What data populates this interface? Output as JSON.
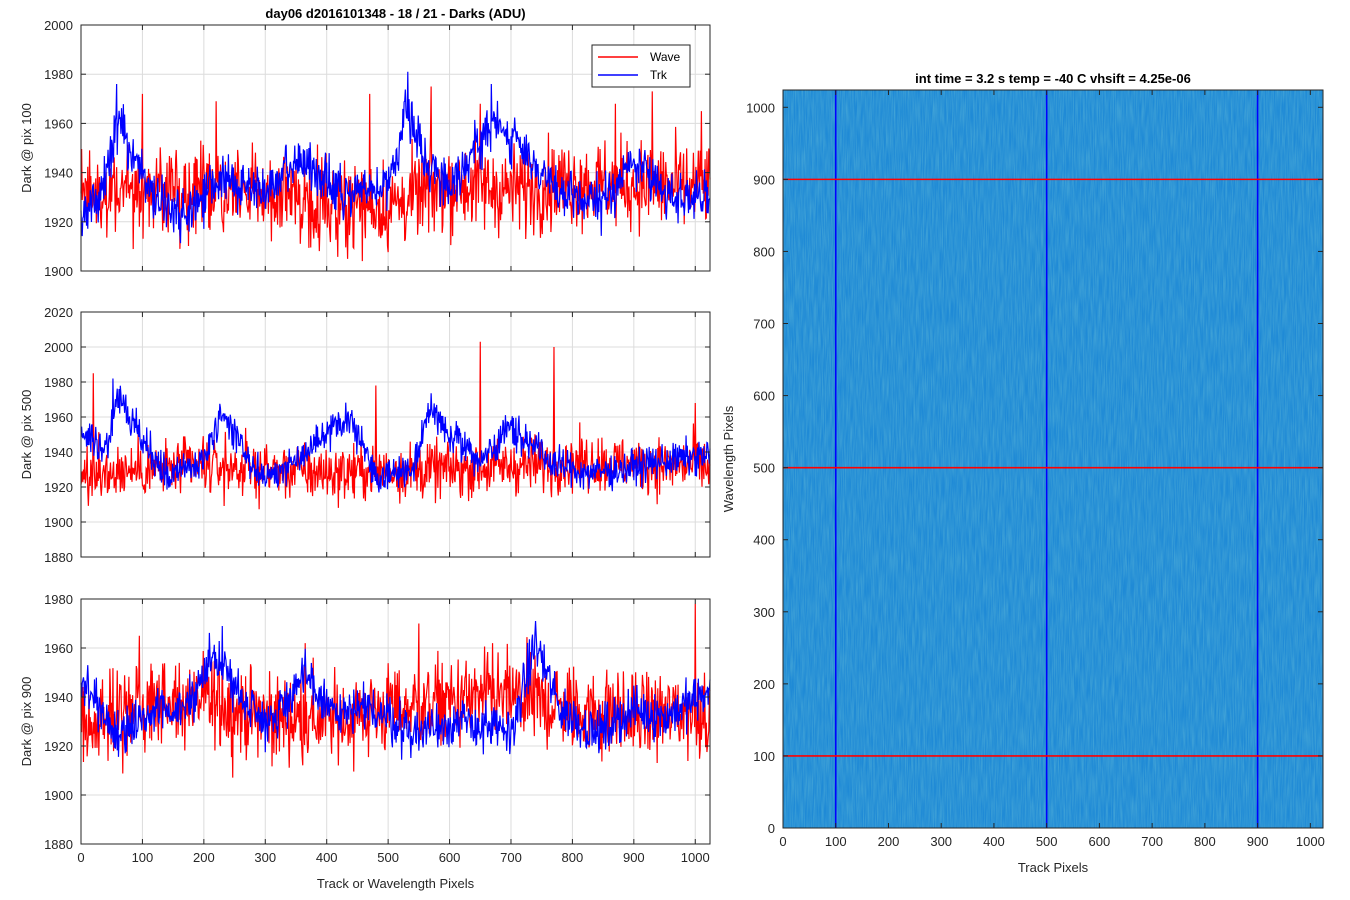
{
  "figure_title": "day06 d2016101348 - 18 / 21 - Darks (ADU)",
  "chart_data": [
    {
      "type": "line",
      "title": "day06 d2016101348 - 18 / 21 - Darks (ADU)",
      "xlabel": "",
      "ylabel": "Dark @ pix 100",
      "xlim": [
        0,
        1024
      ],
      "ylim": [
        1900,
        2000
      ],
      "yticks": [
        1900,
        1920,
        1940,
        1960,
        1980,
        2000
      ],
      "xticks": [
        0,
        100,
        200,
        300,
        400,
        500,
        600,
        700,
        800,
        900,
        1000
      ],
      "grid": true,
      "legend": "top-right",
      "series": [
        {
          "name": "Wave",
          "color": "#ff0000",
          "mean": 1932,
          "noise": 9,
          "knots": [
            [
              0,
              1930
            ],
            [
              100,
              1934
            ],
            [
              200,
              1933
            ],
            [
              300,
              1931
            ],
            [
              400,
              1928
            ],
            [
              500,
              1926
            ],
            [
              600,
              1935
            ],
            [
              700,
              1933
            ],
            [
              800,
              1936
            ],
            [
              900,
              1935
            ],
            [
              1024,
              1934
            ]
          ],
          "peaks": [
            [
              100,
              1972
            ],
            [
              220,
              1969
            ],
            [
              470,
              1972
            ],
            [
              570,
              1975
            ],
            [
              650,
              1968
            ],
            [
              870,
              1968
            ],
            [
              930,
              1973
            ],
            [
              1010,
              1965
            ]
          ]
        },
        {
          "name": "Trk",
          "color": "#0000ff",
          "mean": 1935,
          "noise": 5,
          "knots": [
            [
              0,
              1920
            ],
            [
              30,
              1930
            ],
            [
              60,
              1960
            ],
            [
              80,
              1950
            ],
            [
              120,
              1930
            ],
            [
              170,
              1922
            ],
            [
              230,
              1938
            ],
            [
              300,
              1932
            ],
            [
              360,
              1945
            ],
            [
              430,
              1930
            ],
            [
              500,
              1935
            ],
            [
              530,
              1965
            ],
            [
              560,
              1945
            ],
            [
              600,
              1935
            ],
            [
              670,
              1960
            ],
            [
              720,
              1950
            ],
            [
              780,
              1930
            ],
            [
              850,
              1928
            ],
            [
              900,
              1945
            ],
            [
              950,
              1932
            ],
            [
              1024,
              1928
            ]
          ],
          "peaks": [
            [
              58,
              1976
            ],
            [
              532,
              1981
            ],
            [
              668,
              1976
            ]
          ]
        }
      ]
    },
    {
      "type": "line",
      "title": "",
      "xlabel": "",
      "ylabel": "Dark @ pix 500",
      "xlim": [
        0,
        1024
      ],
      "ylim": [
        1880,
        2020
      ],
      "yticks": [
        1880,
        1900,
        1920,
        1940,
        1960,
        1980,
        2000,
        2020
      ],
      "xticks": [
        0,
        100,
        200,
        300,
        400,
        500,
        600,
        700,
        800,
        900,
        1000
      ],
      "grid": true,
      "series": [
        {
          "name": "Wave",
          "color": "#ff0000",
          "mean": 1928,
          "noise": 8,
          "knots": [
            [
              0,
              1928
            ],
            [
              200,
              1932
            ],
            [
              400,
              1928
            ],
            [
              600,
              1930
            ],
            [
              800,
              1934
            ],
            [
              1024,
              1932
            ]
          ],
          "peaks": [
            [
              20,
              1985
            ],
            [
              650,
              2003
            ],
            [
              770,
              2000
            ],
            [
              480,
              1978
            ],
            [
              1000,
              1968
            ]
          ]
        },
        {
          "name": "Trk",
          "color": "#0000ff",
          "mean": 1935,
          "noise": 5,
          "knots": [
            [
              0,
              1950
            ],
            [
              40,
              1940
            ],
            [
              60,
              1972
            ],
            [
              100,
              1945
            ],
            [
              140,
              1925
            ],
            [
              200,
              1935
            ],
            [
              230,
              1962
            ],
            [
              280,
              1930
            ],
            [
              320,
              1928
            ],
            [
              400,
              1950
            ],
            [
              440,
              1960
            ],
            [
              480,
              1925
            ],
            [
              540,
              1930
            ],
            [
              570,
              1965
            ],
            [
              600,
              1950
            ],
            [
              650,
              1935
            ],
            [
              700,
              1955
            ],
            [
              760,
              1935
            ],
            [
              820,
              1928
            ],
            [
              880,
              1930
            ],
            [
              950,
              1935
            ],
            [
              1024,
              1938
            ]
          ],
          "peaks": [
            [
              52,
              1982
            ]
          ]
        }
      ]
    },
    {
      "type": "line",
      "title": "",
      "xlabel": "Track or Wavelength Pixels",
      "ylabel": "Dark @ pix 900",
      "xlim": [
        0,
        1024
      ],
      "ylim": [
        1880,
        1980
      ],
      "yticks": [
        1880,
        1900,
        1920,
        1940,
        1960,
        1980
      ],
      "xticks": [
        0,
        100,
        200,
        300,
        400,
        500,
        600,
        700,
        800,
        900,
        1000
      ],
      "grid": true,
      "series": [
        {
          "name": "Wave",
          "color": "#ff0000",
          "mean": 1932,
          "noise": 9,
          "knots": [
            [
              0,
              1930
            ],
            [
              100,
              1935
            ],
            [
              200,
              1938
            ],
            [
              300,
              1932
            ],
            [
              400,
              1930
            ],
            [
              500,
              1935
            ],
            [
              600,
              1938
            ],
            [
              700,
              1940
            ],
            [
              800,
              1935
            ],
            [
              900,
              1932
            ],
            [
              1024,
              1935
            ]
          ],
          "peaks": [
            [
              95,
              1965
            ],
            [
              230,
              1962
            ],
            [
              365,
              1962
            ],
            [
              550,
              1970
            ],
            [
              670,
              1962
            ],
            [
              1000,
              1978
            ]
          ]
        },
        {
          "name": "Trk",
          "color": "#0000ff",
          "mean": 1934,
          "noise": 5,
          "knots": [
            [
              0,
              1945
            ],
            [
              60,
              1925
            ],
            [
              130,
              1935
            ],
            [
              180,
              1938
            ],
            [
              220,
              1958
            ],
            [
              260,
              1940
            ],
            [
              310,
              1930
            ],
            [
              360,
              1948
            ],
            [
              420,
              1932
            ],
            [
              480,
              1935
            ],
            [
              540,
              1925
            ],
            [
              600,
              1930
            ],
            [
              650,
              1928
            ],
            [
              700,
              1925
            ],
            [
              740,
              1962
            ],
            [
              780,
              1935
            ],
            [
              840,
              1925
            ],
            [
              900,
              1935
            ],
            [
              950,
              1932
            ],
            [
              1024,
              1942
            ]
          ],
          "peaks": [
            [
              230,
              1969
            ],
            [
              740,
              1971
            ]
          ]
        }
      ]
    },
    {
      "type": "heatmap",
      "title": "int time = 3.2 s   temp = -40 C   vhsift = 4.25e-06",
      "xlabel": "Track Pixels",
      "ylabel": "Wavelength Pixels",
      "xlim": [
        0,
        1024
      ],
      "ylim": [
        0,
        1024
      ],
      "xticks": [
        0,
        100,
        200,
        300,
        400,
        500,
        600,
        700,
        800,
        900,
        1000
      ],
      "yticks": [
        0,
        100,
        200,
        300,
        400,
        500,
        600,
        700,
        800,
        900,
        1000
      ],
      "base_color": "#1f8ad6",
      "vertical_lines": {
        "color": "#0000ff",
        "x": [
          100,
          500,
          900
        ]
      },
      "horizontal_lines": {
        "color": "#ff0000",
        "y": [
          100,
          500,
          900
        ]
      }
    }
  ]
}
